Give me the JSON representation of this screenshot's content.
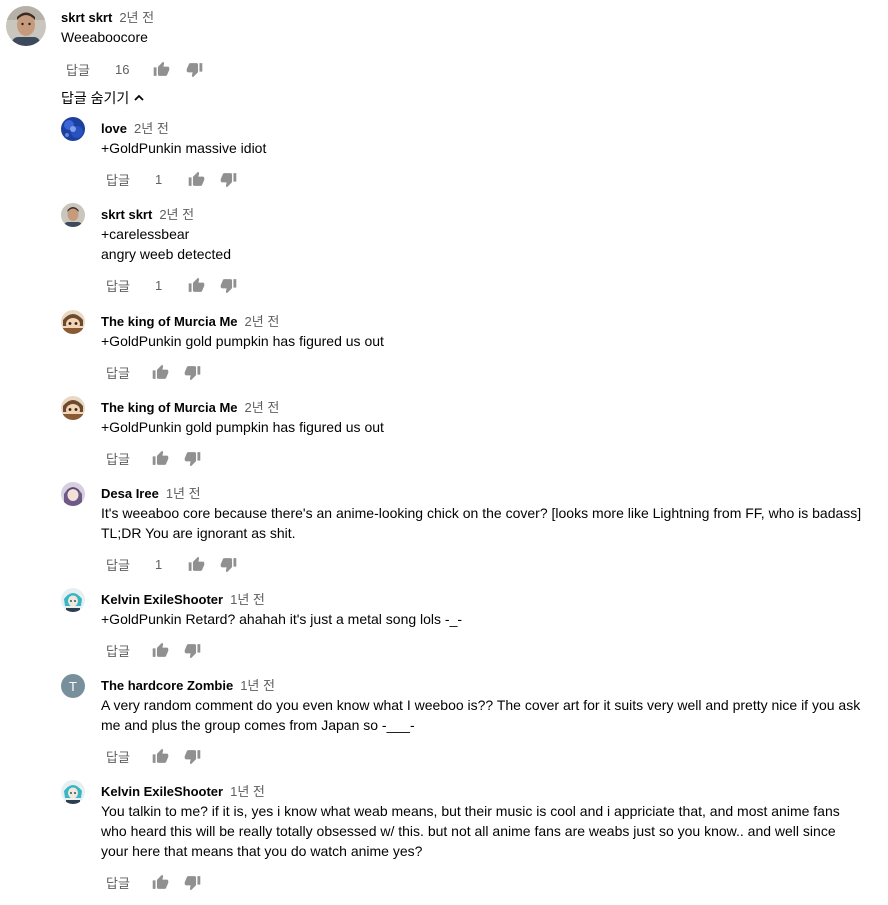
{
  "labels": {
    "reply": "답글",
    "hide_replies": "답글 숨기기"
  },
  "top_comment": {
    "author": "skrt skrt",
    "time": "2년 전",
    "lines": [
      "Weeaboocore"
    ],
    "likes": "16"
  },
  "replies": [
    {
      "author": "love",
      "time": "2년 전",
      "lines": [
        "+GoldPunkin massive idiot"
      ],
      "likes": "1",
      "avatar": "blue-pattern"
    },
    {
      "author": "skrt skrt",
      "time": "2년 전",
      "lines": [
        "+carelessbear",
        "angry weeb detected"
      ],
      "likes": "1",
      "avatar": "photo-face"
    },
    {
      "author": "The king of Murcia Me",
      "time": "2년 전",
      "lines": [
        "+GoldPunkin gold pumpkin has figured us out"
      ],
      "likes": "",
      "avatar": "anime-brown"
    },
    {
      "author": "The king of Murcia Me",
      "time": "2년 전",
      "lines": [
        "+GoldPunkin gold pumpkin has figured us out"
      ],
      "likes": "",
      "avatar": "anime-brown"
    },
    {
      "author": "Desa Iree",
      "time": "1년 전",
      "lines": [
        "It's weeaboo core because there's an anime-looking chick on the cover? [looks more like Lightning from FF, who is badass]",
        "TL;DR You are ignorant as shit."
      ],
      "likes": "1",
      "avatar": "anime-purple"
    },
    {
      "author": "Kelvin ExileShooter",
      "time": "1년 전",
      "lines": [
        "+GoldPunkin Retard? ahahah it's just a metal song lols -_-"
      ],
      "likes": "",
      "avatar": "anime-teal"
    },
    {
      "author": "The hardcore Zombie",
      "time": "1년 전",
      "lines": [
        "A very random comment do you even know what I weeboo is?? The cover art for it suits very well and pretty nice if you ask",
        "me  and plus the group comes from Japan so -___-"
      ],
      "likes": "",
      "avatar": "letter",
      "avatar_letter": "T"
    },
    {
      "author": "Kelvin ExileShooter",
      "time": "1년 전",
      "lines": [
        "You talkin to me? if it is, yes i know what weab means, but their music is cool and i appriciate that, and most anime fans",
        "who heard this will be really totally obsessed w/ this. but not all anime fans are weabs just so you know.. and well since",
        "your here that means that you do watch anime yes?"
      ],
      "likes": "",
      "avatar": "anime-teal"
    }
  ],
  "icons": {
    "like": "thumb-up-icon",
    "dislike": "thumb-down-icon",
    "collapse": "chevron-up-icon"
  },
  "colors": {
    "text": "#030303",
    "secondary": "#606060",
    "icon": "#909090",
    "letter_avatar": "#78909c"
  }
}
